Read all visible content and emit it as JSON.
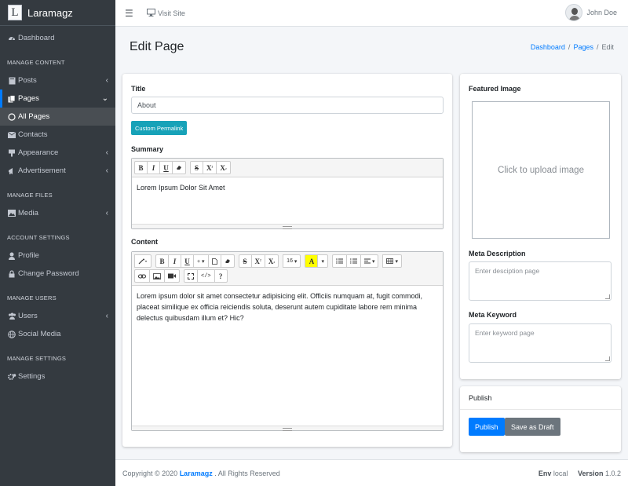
{
  "brand": {
    "letter": "L",
    "name": "Laramagz"
  },
  "sidebar": {
    "dashboard": "Dashboard",
    "manage_content": "MANAGE CONTENT",
    "posts": "Posts",
    "pages": "Pages",
    "all_pages": "All Pages",
    "contacts": "Contacts",
    "appearance": "Appearance",
    "advertisement": "Advertisement",
    "manage_files": "MANAGE FILES",
    "media": "Media",
    "account_settings": "ACCOUNT SETTINGS",
    "profile": "Profile",
    "change_password": "Change Password",
    "manage_users": "MANAGE USERS",
    "users": "Users",
    "social_media": "Social Media",
    "manage_settings": "MANAGE SETTINGS",
    "settings": "Settings"
  },
  "topbar": {
    "visit_site": "Visit Site",
    "user_name": "John Doe"
  },
  "header": {
    "title": "Edit Page",
    "breadcrumb": [
      "Dashboard",
      "Pages",
      "Edit"
    ]
  },
  "form": {
    "title_label": "Title",
    "title_value": "About",
    "custom_permalink": "Custom Permalink",
    "summary_label": "Summary",
    "summary_text": "Lorem Ipsum Dolor Sit Amet",
    "content_label": "Content",
    "content_text": "Lorem ipsum dolor sit amet consectetur adipisicing elit. Officiis numquam at, fugit commodi, placeat similique ex officia reiciendis soluta, deserunt autem cupiditate labore rem minima delectus quibusdam illum et? Hic?",
    "font_size": "16"
  },
  "side": {
    "featured_image_label": "Featured Image",
    "upload_text": "Click to upload image",
    "meta_description_label": "Meta Description",
    "meta_description_placeholder": "Enter desciption page",
    "meta_keyword_label": "Meta Keyword",
    "meta_keyword_placeholder": "Enter keyword page"
  },
  "publish": {
    "header": "Publish",
    "publish_button": "Publish",
    "draft_button": "Save as Draft"
  },
  "footer": {
    "copyright_prefix": "Copyright © 2020",
    "brand": "Laramagz",
    "suffix": ". All Rights Reserved",
    "env_label": "Env",
    "env_value": "local",
    "version_label": "Version",
    "version_value": "1.0.2"
  },
  "colors": {
    "primary": "#007bff",
    "info": "#17a2b8",
    "sidebar": "#343a40",
    "secondary": "#6c757d"
  }
}
